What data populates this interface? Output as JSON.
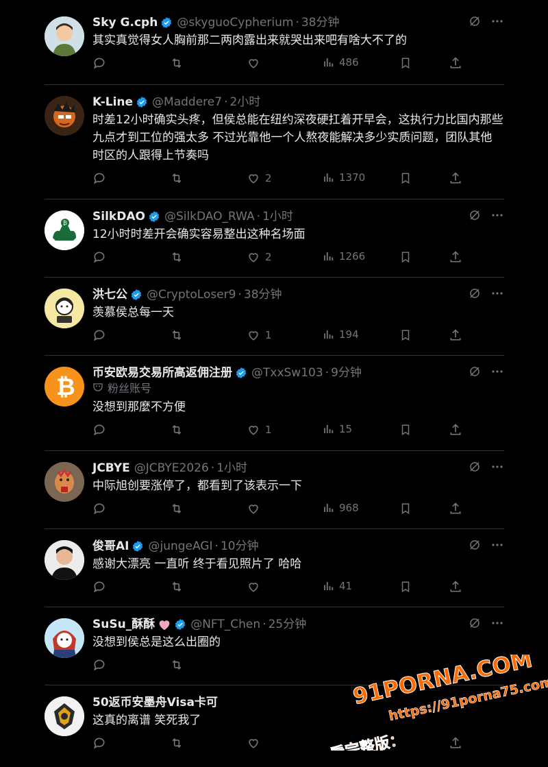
{
  "tweets": [
    {
      "name": "Sky G.cph",
      "handle": "@skyguoCypherium",
      "time": "38分钟",
      "text": "其实真觉得女人胸前那二两肉露出来就哭出来吧有啥大不了的",
      "likes": "",
      "views": "486"
    },
    {
      "name": "K-Line",
      "handle": "@Maddere7",
      "time": "2小时",
      "text": "时差12小时确实头疼，但侯总能在纽约深夜硬扛着开早会，这执行力比国内那些九点才到工位的强太多 不过光靠他一个人熬夜能解决多少实质问题，团队其他时区的人跟得上节奏吗",
      "likes": "2",
      "views": "1370"
    },
    {
      "name": "SilkDAO",
      "handle": "@SilkDAO_RWA",
      "time": "1小时",
      "text": "12小时时差开会确实容易整出这种名场面",
      "likes": "2",
      "views": "1266"
    },
    {
      "name": "洪七公",
      "handle": "@CryptoLoser9",
      "time": "38分钟",
      "text": "羡慕侯总每一天",
      "likes": "1",
      "views": "194"
    },
    {
      "name": "币安欧易交易所高返佣注册",
      "handle": "@TxxSw103",
      "time": "9分钟",
      "badge": "粉丝账号",
      "text": "没想到那麼不方便",
      "likes": "1",
      "views": "15"
    },
    {
      "name": "JCBYE",
      "handle": "@JCBYE2026",
      "time": "1小时",
      "text": "中际旭创要涨停了，都看到了该表示一下",
      "likes": "",
      "views": "968"
    },
    {
      "name": "俊哥AI",
      "handle": "@jungeAGI",
      "time": "10分钟",
      "text": "感谢大漂亮 一直听 终于看见照片了 哈哈",
      "likes": "",
      "views": "41"
    },
    {
      "name": "SuSu_酥酥",
      "handle": "@NFT_Chen",
      "time": "25分钟",
      "text": "没想到侯总是这么出圈的",
      "likes": "",
      "views": ""
    },
    {
      "name": "50返币安墨舟Visa卡可",
      "handle": "",
      "time": "",
      "text": "这真的离谱 笑死我了",
      "likes": "",
      "views": ""
    }
  ],
  "watermark": {
    "line1": "91PORNA.COM",
    "line2": "https://91porna75.com",
    "line3": "看完整版："
  },
  "colors": {
    "background": "#000000",
    "text": "#e7e9ea",
    "muted": "#71767b",
    "verified": "#1d9bf0",
    "watermark": "#ff6a00"
  }
}
